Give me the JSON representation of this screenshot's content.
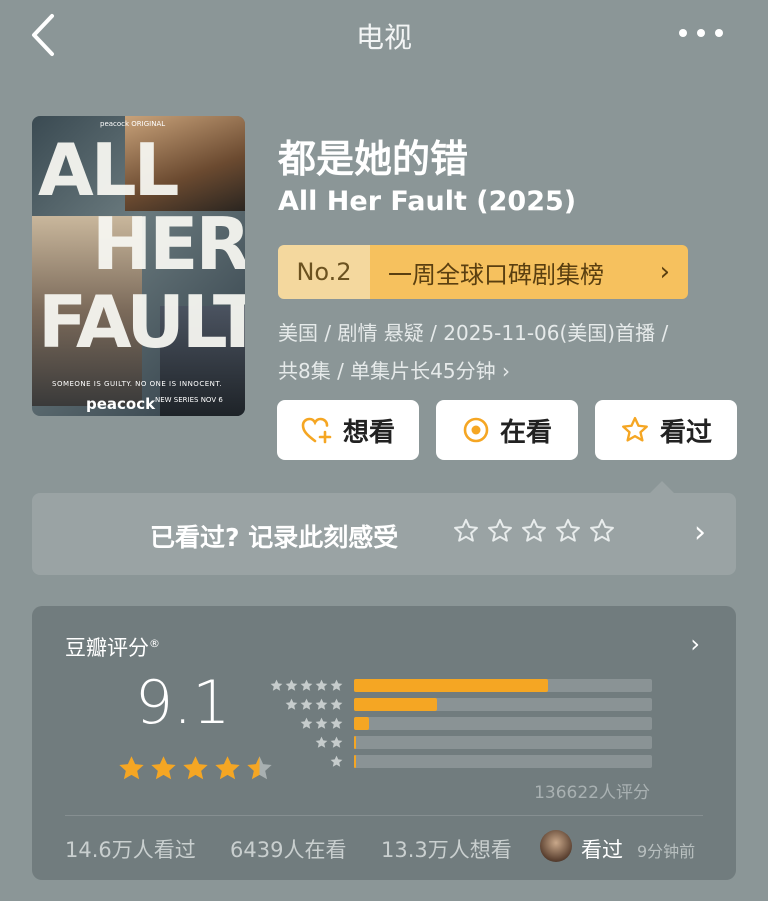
{
  "nav": {
    "title": "电视"
  },
  "poster": {
    "top_brand": "peacock ORIGINAL",
    "line1": "ALL",
    "line2": "HER",
    "line3": "FAULT",
    "tagline": "SOMEONE IS GUILTY. NO ONE IS INNOCENT.",
    "brand": "peacock",
    "date": "NEW SERIES NOV 6"
  },
  "title_cn": "都是她的错",
  "title_en": "All Her Fault (2025)",
  "rank": {
    "number": "No.2",
    "label": "一周全球口碑剧集榜",
    "chevron": "›"
  },
  "meta": {
    "line1": "美国 / 剧情 悬疑 / 2025-11-06(美国)首播 /",
    "line2": "共8集 / 单集片长45分钟 ›"
  },
  "actions": [
    {
      "label": "想看",
      "icon": "heart-plus-icon"
    },
    {
      "label": "在看",
      "icon": "target-icon"
    },
    {
      "label": "看过",
      "icon": "star-outline-icon"
    }
  ],
  "record": {
    "text": "已看过? 记录此刻感受",
    "chevron": "›"
  },
  "rating": {
    "title": "豆瓣评分",
    "reg": "®",
    "chevron": "›",
    "score": "9.1",
    "stars": 4.5,
    "distribution": [
      0.65,
      0.28,
      0.05,
      0.006,
      0.005
    ],
    "count": "136622人评分"
  },
  "footer": {
    "watched_count": "14.6万人看过",
    "watching_count": "6439人在看",
    "want_count": "13.3万人想看",
    "recent_label": "看过",
    "recent_time": "9分钟前"
  },
  "colors": {
    "accent": "#f5a623",
    "rank_badge": "#f6c15e",
    "background": "#8b9697"
  }
}
